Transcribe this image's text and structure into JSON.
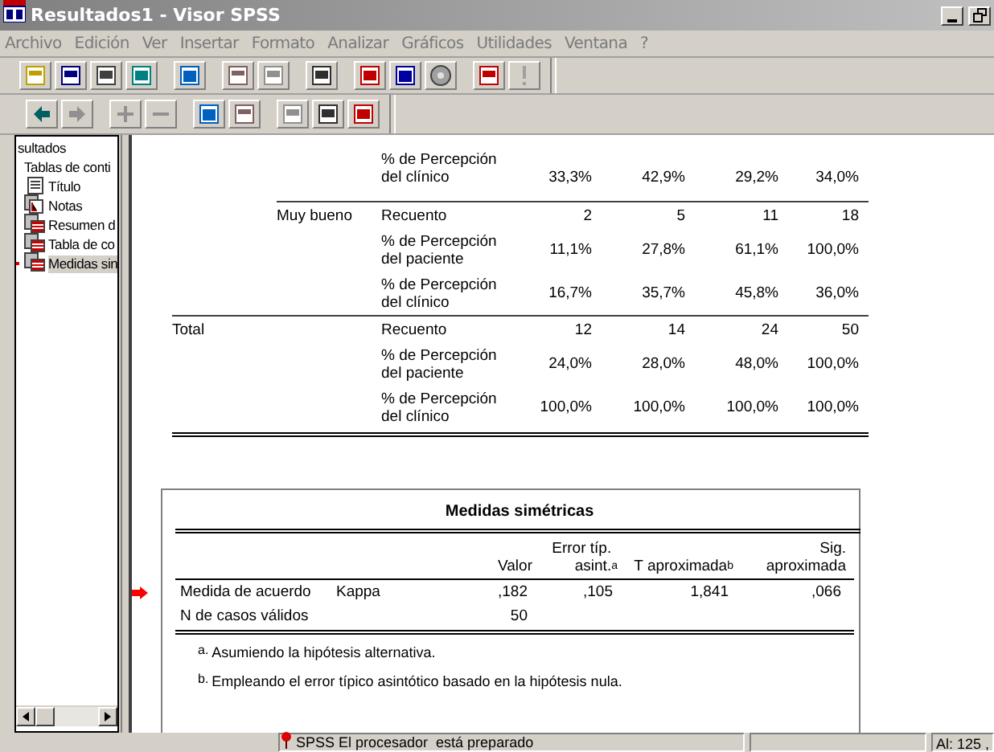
{
  "window": {
    "title": "Resultados1 - Visor SPSS"
  },
  "menu": [
    "Archivo",
    "Edición",
    "Ver",
    "Insertar",
    "Formato",
    "Analizar",
    "Gráficos",
    "Utilidades",
    "Ventana",
    "?"
  ],
  "tree": {
    "label": "sultados",
    "children": [
      {
        "label": "Tablas de conti",
        "kind": "plain",
        "selected": false
      },
      {
        "label": "Título",
        "kind": "title",
        "selected": false
      },
      {
        "label": "Notas",
        "kind": "notes",
        "selected": false
      },
      {
        "label": "Resumen d",
        "kind": "table",
        "selected": false
      },
      {
        "label": "Tabla de co",
        "kind": "table",
        "selected": false
      },
      {
        "label": "Medidas sin",
        "kind": "table",
        "selected": true
      }
    ]
  },
  "crosstab": {
    "rows": [
      {
        "col_1": "",
        "col_2": "",
        "label": "% de Percepción del clínico",
        "cells": [
          "33,3%",
          "42,9%",
          "29,2%",
          "34,0%"
        ]
      },
      {
        "col_1": "",
        "col_2": "Muy bueno",
        "label": "Recuento",
        "cells": [
          "2",
          "5",
          "11",
          "18"
        ]
      },
      {
        "col_1": "",
        "col_2": "",
        "label": "% de Percepción del paciente",
        "cells": [
          "11,1%",
          "27,8%",
          "61,1%",
          "100,0%"
        ]
      },
      {
        "col_1": "",
        "col_2": "",
        "label": "% de Percepción del clínico",
        "cells": [
          "16,7%",
          "35,7%",
          "45,8%",
          "36,0%"
        ]
      },
      {
        "col_1": "Total",
        "col_2": "",
        "label": "Recuento",
        "cells": [
          "12",
          "14",
          "24",
          "50"
        ]
      },
      {
        "col_1": "",
        "col_2": "",
        "label": "% de Percepción del paciente",
        "cells": [
          "24,0%",
          "28,0%",
          "48,0%",
          "100,0%"
        ]
      },
      {
        "col_1": "",
        "col_2": "",
        "label": "% de Percepción del clínico",
        "cells": [
          "100,0%",
          "100,0%",
          "100,0%",
          "100,0%"
        ]
      }
    ]
  },
  "symmetric_table": {
    "title": "Medidas simétricas",
    "columns": [
      "Valor",
      "Error típ. asint.$^{a}$",
      "T aproximada$^{b}$",
      "Sig. aproximada"
    ],
    "rows": [
      {
        "col_1": "Medida de acuerdo",
        "col_2": "Kappa",
        "cells": [
          ",182",
          ",105",
          "1,841",
          ",066"
        ],
        "pointer": true
      },
      {
        "col_1": "N de casos válidos",
        "col_2": "",
        "cells": [
          "50",
          "",
          "",
          ""
        ],
        "pointer": false
      }
    ],
    "footnotes": [
      {
        "mark": "a.",
        "text": "Asumiendo la hipótesis alternativa."
      },
      {
        "mark": "b.",
        "text": "Empleando el error típico asintótico basado en la hipótesis nula."
      }
    ]
  },
  "status_bar": {
    "message": "SPSS El procesador  está preparado",
    "position": "Al: 125 ,"
  }
}
